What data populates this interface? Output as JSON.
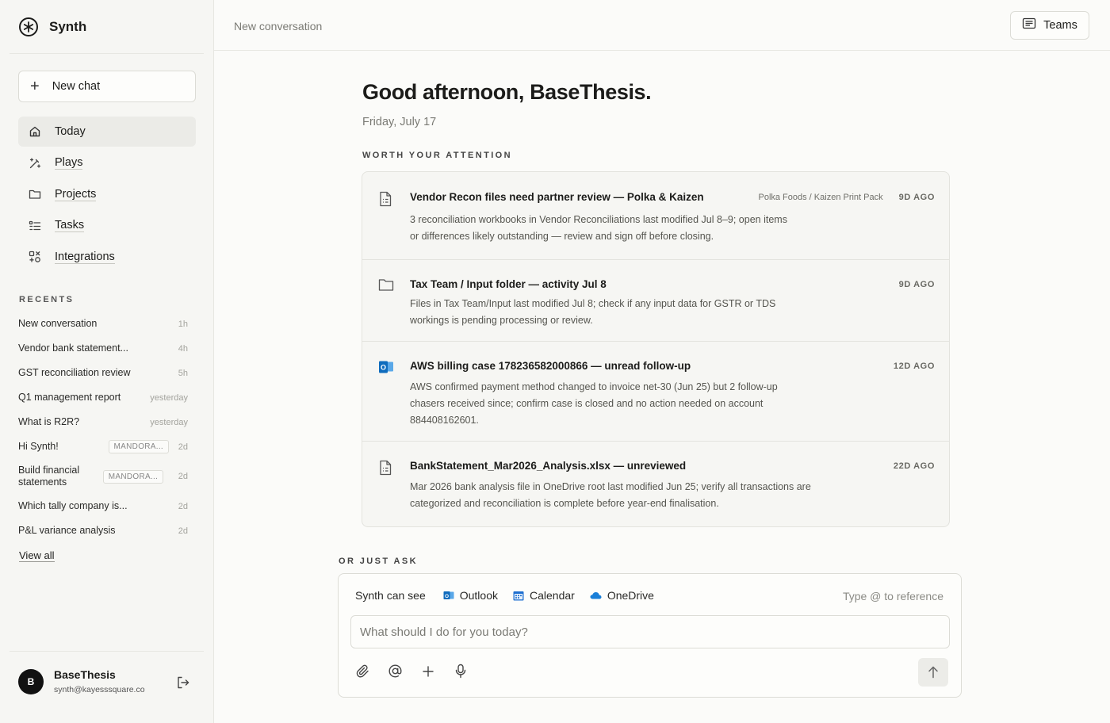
{
  "brand": {
    "name": "Synth"
  },
  "sidebar": {
    "new_chat_label": "New chat",
    "nav": [
      {
        "label": "Today",
        "icon": "home-icon"
      },
      {
        "label": "Plays",
        "icon": "wand-icon"
      },
      {
        "label": "Projects",
        "icon": "folder-icon"
      },
      {
        "label": "Tasks",
        "icon": "checklist-icon"
      },
      {
        "label": "Integrations",
        "icon": "integrations-icon"
      }
    ],
    "recents_title": "RECENTS",
    "recents": [
      {
        "title": "New conversation",
        "time": "1h",
        "tag": ""
      },
      {
        "title": "Vendor bank statement...",
        "time": "4h",
        "tag": ""
      },
      {
        "title": "GST reconciliation review",
        "time": "5h",
        "tag": ""
      },
      {
        "title": "Q1 management report",
        "time": "yesterday",
        "tag": ""
      },
      {
        "title": "What is R2R?",
        "time": "yesterday",
        "tag": ""
      },
      {
        "title": "Hi Synth!",
        "time": "2d",
        "tag": "MANDORA..."
      },
      {
        "title": "Build financial statements",
        "time": "2d",
        "tag": "MANDORA..."
      },
      {
        "title": "Which tally company is...",
        "time": "2d",
        "tag": ""
      },
      {
        "title": "P&L variance analysis",
        "time": "2d",
        "tag": ""
      }
    ],
    "view_all": "View all",
    "user": {
      "initial": "B",
      "name": "BaseThesis",
      "email": "synth@kayesssquare.co"
    }
  },
  "header": {
    "title": "New conversation",
    "teams_label": "Teams"
  },
  "main": {
    "greeting": "Good afternoon, BaseThesis.",
    "date": "Friday, July 17",
    "attention_label": "WORTH YOUR ATTENTION",
    "cards": [
      {
        "icon": "document-icon",
        "title": "Vendor Recon files need partner review — Polka & Kaizen",
        "context": "Polka Foods / Kaizen Print Pack",
        "age": "9D AGO",
        "desc": "3 reconciliation workbooks in Vendor Reconciliations last modified Jul 8–9; open items or differences likely outstanding — review and sign off before closing."
      },
      {
        "icon": "folder-icon",
        "title": "Tax Team / Input folder — activity Jul 8",
        "context": "",
        "age": "9D AGO",
        "desc": "Files in Tax Team/Input last modified Jul 8; check if any input data for GSTR or TDS workings is pending processing or review."
      },
      {
        "icon": "outlook-icon",
        "title": "AWS billing case 178236582000866 — unread follow-up",
        "context": "",
        "age": "12D AGO",
        "desc": "AWS confirmed payment method changed to invoice net-30 (Jun 25) but 2 follow-up chasers received since; confirm case is closed and no action needed on account 884408162601."
      },
      {
        "icon": "document-icon",
        "title": "BankStatement_Mar2026_Analysis.xlsx — unreviewed",
        "context": "",
        "age": "22D AGO",
        "desc": "Mar 2026 bank analysis file in OneDrive root last modified Jun 25; verify all transactions are categorized and reconciliation is complete before year-end finalisation."
      }
    ],
    "ask_label": "OR JUST ASK",
    "ask": {
      "sees_label": "Synth can see",
      "sources": [
        "Outlook",
        "Calendar",
        "OneDrive"
      ],
      "reference_hint": "Type @ to reference",
      "placeholder": "What should I do for you today?"
    }
  },
  "colors": {
    "outlook": "#0f6cbd",
    "onedrive": "#1a7fd8",
    "calendar": "#1e6fd0"
  }
}
